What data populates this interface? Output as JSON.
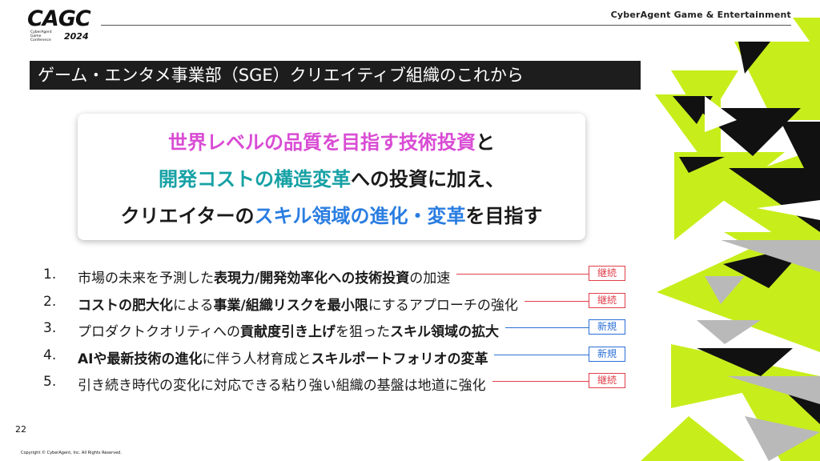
{
  "header": {
    "logo_mark": "CAGC",
    "logo_sub": "CyberAgent Game Conference",
    "logo_year": "2024",
    "company": "CyberAgent Game & Entertainment"
  },
  "title": "ゲーム・エンタメ事業部（SGE）クリエイティブ組織のこれから",
  "message": {
    "line1_pink": "世界レベルの品質を目指す技術投資",
    "line1_tail": "と",
    "line2_teal": "開発コストの構造変革",
    "line2_tail": "への投資に加え、",
    "line3_head": "クリエイターの",
    "line3_blue": "スキル領域の進化・変革",
    "line3_tail": "を目指す"
  },
  "items": [
    {
      "num": "1.",
      "segments": [
        {
          "t": "市場の未来を予測した"
        },
        {
          "t": "表現力/開発効率化への技術投資",
          "b": true
        },
        {
          "t": "の加速"
        }
      ],
      "badge": "継続",
      "type": "cont"
    },
    {
      "num": "2.",
      "segments": [
        {
          "t": "コストの肥大化",
          "b": true
        },
        {
          "t": "による"
        },
        {
          "t": "事業/組織リスクを最小限",
          "b": true
        },
        {
          "t": "にするアプローチの強化"
        }
      ],
      "badge": "継続",
      "type": "cont"
    },
    {
      "num": "3.",
      "segments": [
        {
          "t": "プロダクトクオリティへの"
        },
        {
          "t": "貢献度引き上げ",
          "b": true
        },
        {
          "t": "を狙った"
        },
        {
          "t": "スキル領域の拡大",
          "b": true
        }
      ],
      "badge": "新規",
      "type": "new"
    },
    {
      "num": "4.",
      "segments": [
        {
          "t": "AIや最新技術の進化",
          "b": true
        },
        {
          "t": "に伴う人材育成と"
        },
        {
          "t": "スキルポートフォリオの変革",
          "b": true
        }
      ],
      "badge": "新規",
      "type": "new"
    },
    {
      "num": "5.",
      "segments": [
        {
          "t": "引き続き時代の変化に対応できる粘り強い組織の基盤は地道に強化"
        }
      ],
      "badge": "継続",
      "type": "cont"
    }
  ],
  "page_number": "22",
  "copyright": "Copyright © CyberAgent, Inc. All Rights Reserved.",
  "colors": {
    "accent_green": "#c7ee1b",
    "pink": "#d94cd4",
    "teal": "#16a1a5",
    "blue": "#2a7de1",
    "badge_red": "#e0404a",
    "badge_blue": "#2a6fd6"
  }
}
